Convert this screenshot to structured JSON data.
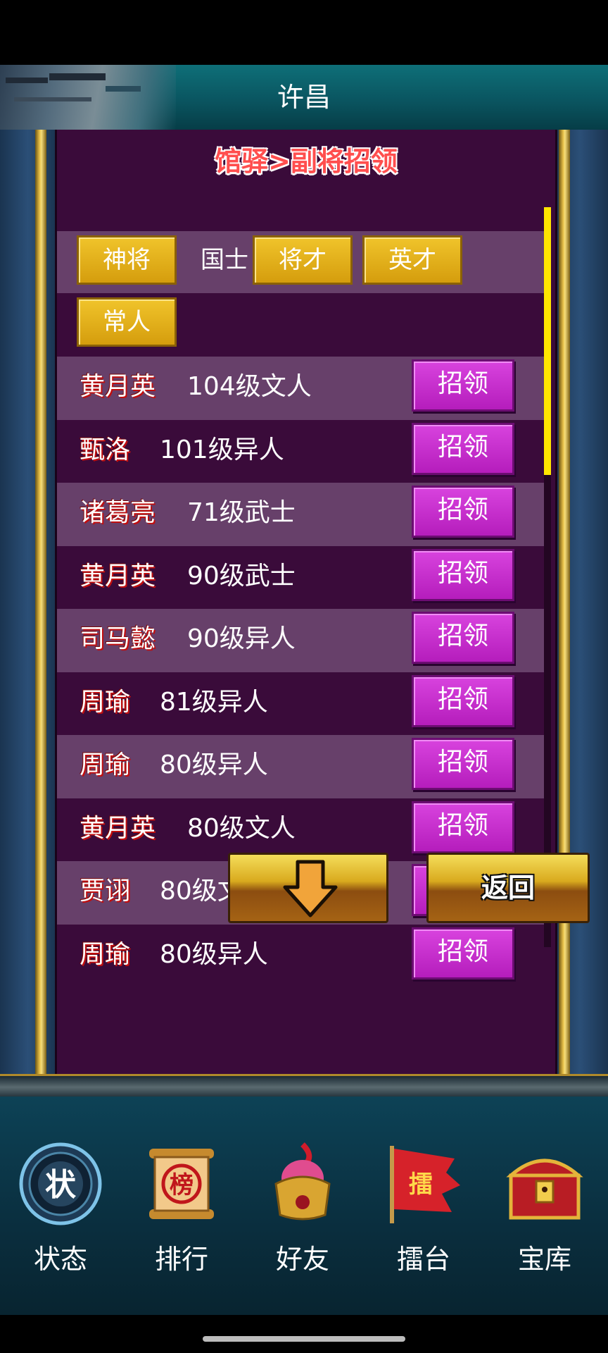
{
  "header": {
    "title": "许昌"
  },
  "panel": {
    "title": "馆驿>副将招领"
  },
  "filters": {
    "row1": [
      "神将",
      "国士",
      "将才",
      "英才"
    ],
    "row2": [
      "常人"
    ]
  },
  "recruit_label": "招领",
  "list": [
    {
      "name": "黄月英",
      "info": "104级文人"
    },
    {
      "name": "甄洛",
      "info": "101级异人"
    },
    {
      "name": "诸葛亮",
      "info": "71级武士"
    },
    {
      "name": "黄月英",
      "info": "90级武士"
    },
    {
      "name": "司马懿",
      "info": "90级异人"
    },
    {
      "name": "周瑜",
      "info": "81级异人"
    },
    {
      "name": "周瑜",
      "info": "80级异人"
    },
    {
      "name": "黄月英",
      "info": "80级文人"
    },
    {
      "name": "贾诩",
      "info": "80级文人"
    },
    {
      "name": "周瑜",
      "info": "80级异人"
    }
  ],
  "nav": {
    "back_label": "返回",
    "down_icon": "arrow-down-icon"
  },
  "tabs": [
    {
      "label": "状态",
      "icon": "status-seal-icon",
      "glyph": "状"
    },
    {
      "label": "排行",
      "icon": "ranking-scroll-icon",
      "glyph": "榜"
    },
    {
      "label": "好友",
      "icon": "helmet-icon"
    },
    {
      "label": "擂台",
      "icon": "arena-flag-icon",
      "glyph": "擂"
    },
    {
      "label": "宝库",
      "icon": "treasure-chest-icon"
    }
  ],
  "colors": {
    "panel_bg": "#3a0b3a",
    "row_alt_bg": "#67406a",
    "gold_button": "#e2b01c",
    "purple_button": "#c62fcd",
    "scroll_thumb": "#ffe600",
    "title_red": "#ff4e4e"
  }
}
